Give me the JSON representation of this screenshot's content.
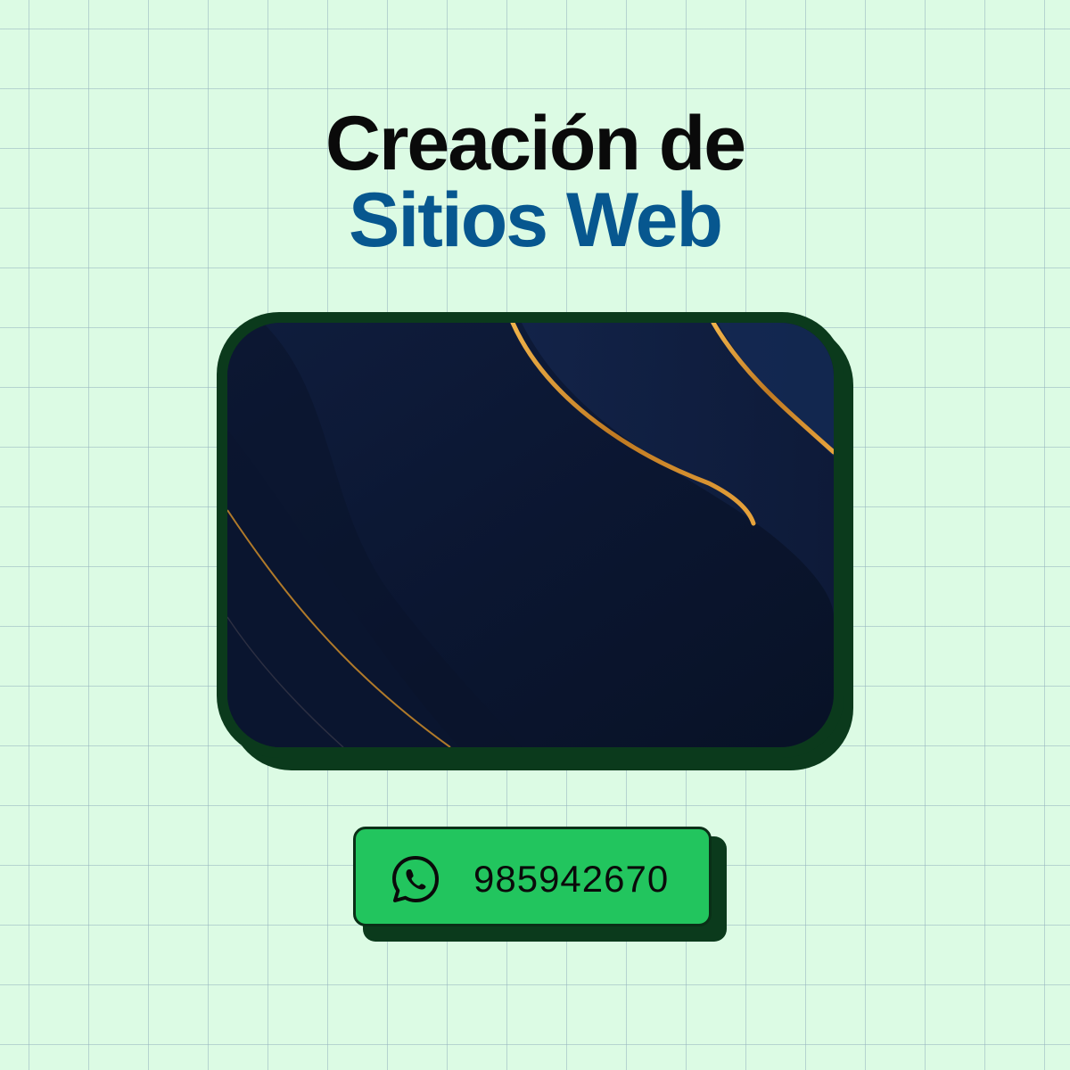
{
  "title": {
    "line1": "Creación de",
    "line2": "Sitios Web"
  },
  "colors": {
    "background": "#dcfbe4",
    "title_dark": "#0a0a0a",
    "title_accent": "#07578f",
    "frame": "#0b3a1c",
    "artwork_navy": "#0c1732",
    "artwork_gold": "#d8952e",
    "button_green": "#22c55e"
  },
  "image": {
    "icon": "abstract-navy-gold-waves"
  },
  "contact": {
    "icon": "whatsapp-icon",
    "phone": "985942670"
  }
}
